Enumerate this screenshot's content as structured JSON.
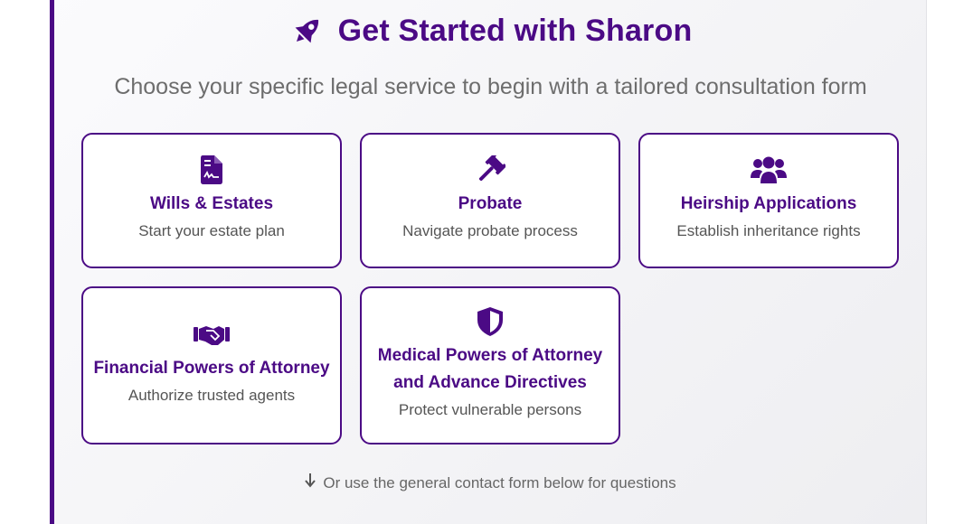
{
  "header": {
    "title": "Get Started with Sharon",
    "subtitle": "Choose your specific legal service to begin with a tailored consultation form",
    "icon": "rocket-icon"
  },
  "colors": {
    "accent": "#4b0a85",
    "text_muted": "#555555"
  },
  "services": [
    {
      "title": "Wills & Estates",
      "description": "Start your estate plan",
      "icon": "file-contract-icon"
    },
    {
      "title": "Probate",
      "description": "Navigate probate process",
      "icon": "gavel-icon"
    },
    {
      "title": "Heirship Applications",
      "description": "Establish inheritance rights",
      "icon": "users-icon"
    },
    {
      "title": "Financial Powers of Attorney",
      "description": "Authorize trusted agents",
      "icon": "handshake-icon"
    },
    {
      "title_line1": "Medical Powers of Attorney",
      "title_line2": "and Advance Directives",
      "description": "Protect vulnerable persons",
      "icon": "shield-icon"
    }
  ],
  "footer": {
    "note": "Or use the general contact form below for questions",
    "icon": "arrow-down-icon"
  }
}
